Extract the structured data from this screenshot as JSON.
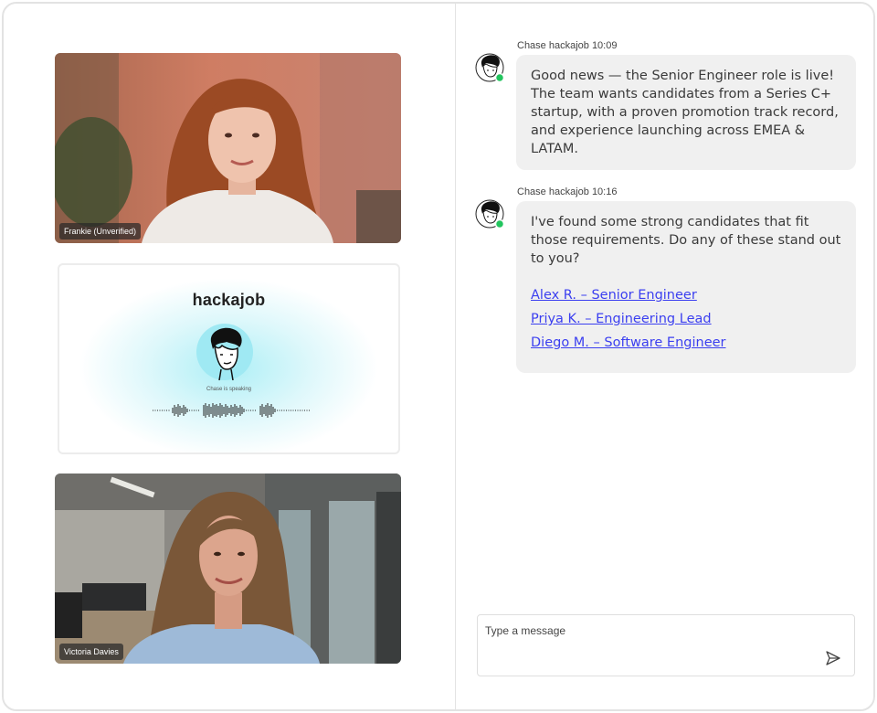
{
  "participants": {
    "top_name": "Frankie (Unverified)",
    "bottom_name": "Victoria Davies"
  },
  "assistant_tile": {
    "logo_text": "hackajob",
    "status_text": "Chase is speaking"
  },
  "chat": {
    "messages": [
      {
        "sender": "Chase hackajob 10:09",
        "text": "Good news — the Senior Engineer role is live! The team wants candidates from a Series C+ startup, with a proven promotion track record, and experience launching across EMEA & LATAM."
      },
      {
        "sender": "Chase hackajob 10:16",
        "text": "I've found some strong candidates that fit those requirements. Do any of these stand out to you?",
        "candidates": [
          "Alex R. – Senior Engineer",
          "Priya K. – Engineering Lead",
          "Diego M. – Software Engineer"
        ]
      }
    ]
  },
  "composer": {
    "placeholder": "Type a message",
    "send_icon": "send-icon"
  },
  "colors": {
    "link": "#3b3ff0",
    "online": "#22c55e",
    "bubble": "#f0f0f0",
    "avatar_bg": "#b8f0f6"
  }
}
